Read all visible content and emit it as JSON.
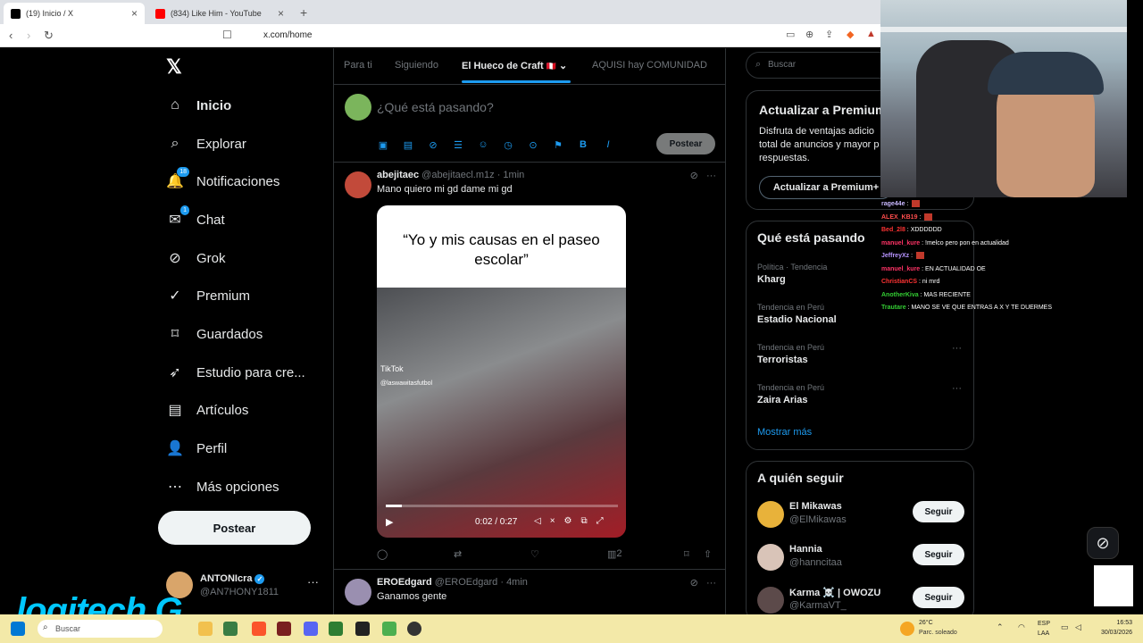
{
  "browser": {
    "tabs": [
      {
        "label": "(19) Inicio / X",
        "color": "#000000"
      },
      {
        "label": "(834) Like Him - YouTube",
        "color": "#ff0000"
      }
    ],
    "url": "x.com/home"
  },
  "nav": {
    "items": [
      {
        "label": "Inicio",
        "icon": "home-icon",
        "badge": ""
      },
      {
        "label": "Explorar",
        "icon": "search-icon",
        "badge": ""
      },
      {
        "label": "Notificaciones",
        "icon": "bell-icon",
        "badge": "18"
      },
      {
        "label": "Chat",
        "icon": "chat-icon",
        "badge": "1"
      },
      {
        "label": "Grok",
        "icon": "grok-icon",
        "badge": ""
      },
      {
        "label": "Premium",
        "icon": "premium-icon",
        "badge": ""
      },
      {
        "label": "Guardados",
        "icon": "bookmark-icon",
        "badge": ""
      },
      {
        "label": "Estudio para cre...",
        "icon": "rocket-icon",
        "badge": ""
      },
      {
        "label": "Artículos",
        "icon": "article-icon",
        "badge": ""
      },
      {
        "label": "Perfil",
        "icon": "person-icon",
        "badge": ""
      },
      {
        "label": "Más opciones",
        "icon": "more-icon",
        "badge": ""
      }
    ],
    "post_label": "Postear",
    "account": {
      "name": "ANTONIcra",
      "handle": "@AN7HONY1811"
    }
  },
  "feed": {
    "tabs": [
      "Para ti",
      "Siguiendo",
      "El Hueco de Craft",
      "AQUISI hay COMUNIDAD"
    ],
    "composer_placeholder": "¿Qué está pasando?",
    "composer_post": "Postear",
    "tweets": [
      {
        "name": "abejitaec",
        "handle": "@abejitaecl.m1z",
        "time": "1min",
        "text": "Mano quiero mi gd dame mi gd",
        "media_caption": "“Yo y mis causas en el paseo escolar”",
        "video_tiktok": "TikTok",
        "video_handle": "@laswawitasfutbol",
        "video_time": "0:02 / 0:27",
        "video_progress": 0.07,
        "views": "2"
      },
      {
        "name": "EROEdgard",
        "handle": "@EROEdgard",
        "time": "4min",
        "text": "Ganamos gente"
      }
    ]
  },
  "sidebar": {
    "search_placeholder": "Buscar",
    "premium": {
      "title": "Actualizar a Premium",
      "desc": "Disfruta de ventajas adicio total de anuncios y mayor p respuestas.",
      "button": "Actualizar a Premium+"
    },
    "trends_title": "Qué está pasando",
    "trends": [
      {
        "category": "Política · Tendencia",
        "name": "Kharg"
      },
      {
        "category": "Tendencia en Perú",
        "name": "Estadio Nacional"
      },
      {
        "category": "Tendencia en Perú",
        "name": "Terroristas"
      },
      {
        "category": "Tendencia en Perú",
        "name": "Zaira Arias"
      }
    ],
    "show_more": "Mostrar más",
    "follow_title": "A quién seguir",
    "follow": [
      {
        "name": "El Mikawas",
        "handle": "@ElMikawas",
        "button": "Seguir"
      },
      {
        "name": "Hannia",
        "handle": "@hanncitaa",
        "button": "Seguir"
      },
      {
        "name": "Karma ☠️ | OWOZU",
        "handle": "@KarmaVT_",
        "button": "Seguir"
      }
    ]
  },
  "chat": [
    {
      "user": "rage44e",
      "text": "",
      "color": "#c9b8ff"
    },
    {
      "user": "ALEX_KB19",
      "text": "",
      "color": "#ff4d4d"
    },
    {
      "user": "Bed_2l8",
      "text": "XDDDDDD",
      "color": "#ff3333"
    },
    {
      "user": "manuel_kure",
      "text": "!melco pero pon en actualidad",
      "color": "#ff3366"
    },
    {
      "user": "JeffreyXz",
      "text": "",
      "color": "#b794ff"
    },
    {
      "user": "manuel_kure",
      "text": "EN ACTUALIDAD OE",
      "color": "#ff3366"
    },
    {
      "user": "ChristianCS",
      "text": "ni mrd",
      "color": "#ff3333"
    },
    {
      "user": "AnotherKiva",
      "text": "MAS RECIENTE",
      "color": "#33cc33"
    },
    {
      "user": "Trautare",
      "text": "MANO SE VE QUE ENTRAS A X Y TE DUERMES",
      "color": "#33cc33"
    }
  ],
  "overlay": {
    "brand": "logitech G"
  },
  "taskbar": {
    "search": "Buscar",
    "weather_temp": "26°C",
    "weather_desc": "Parc. soleado",
    "lang": "ESP",
    "region": "LAA",
    "time": "16:53",
    "date": "30/03/2026"
  }
}
